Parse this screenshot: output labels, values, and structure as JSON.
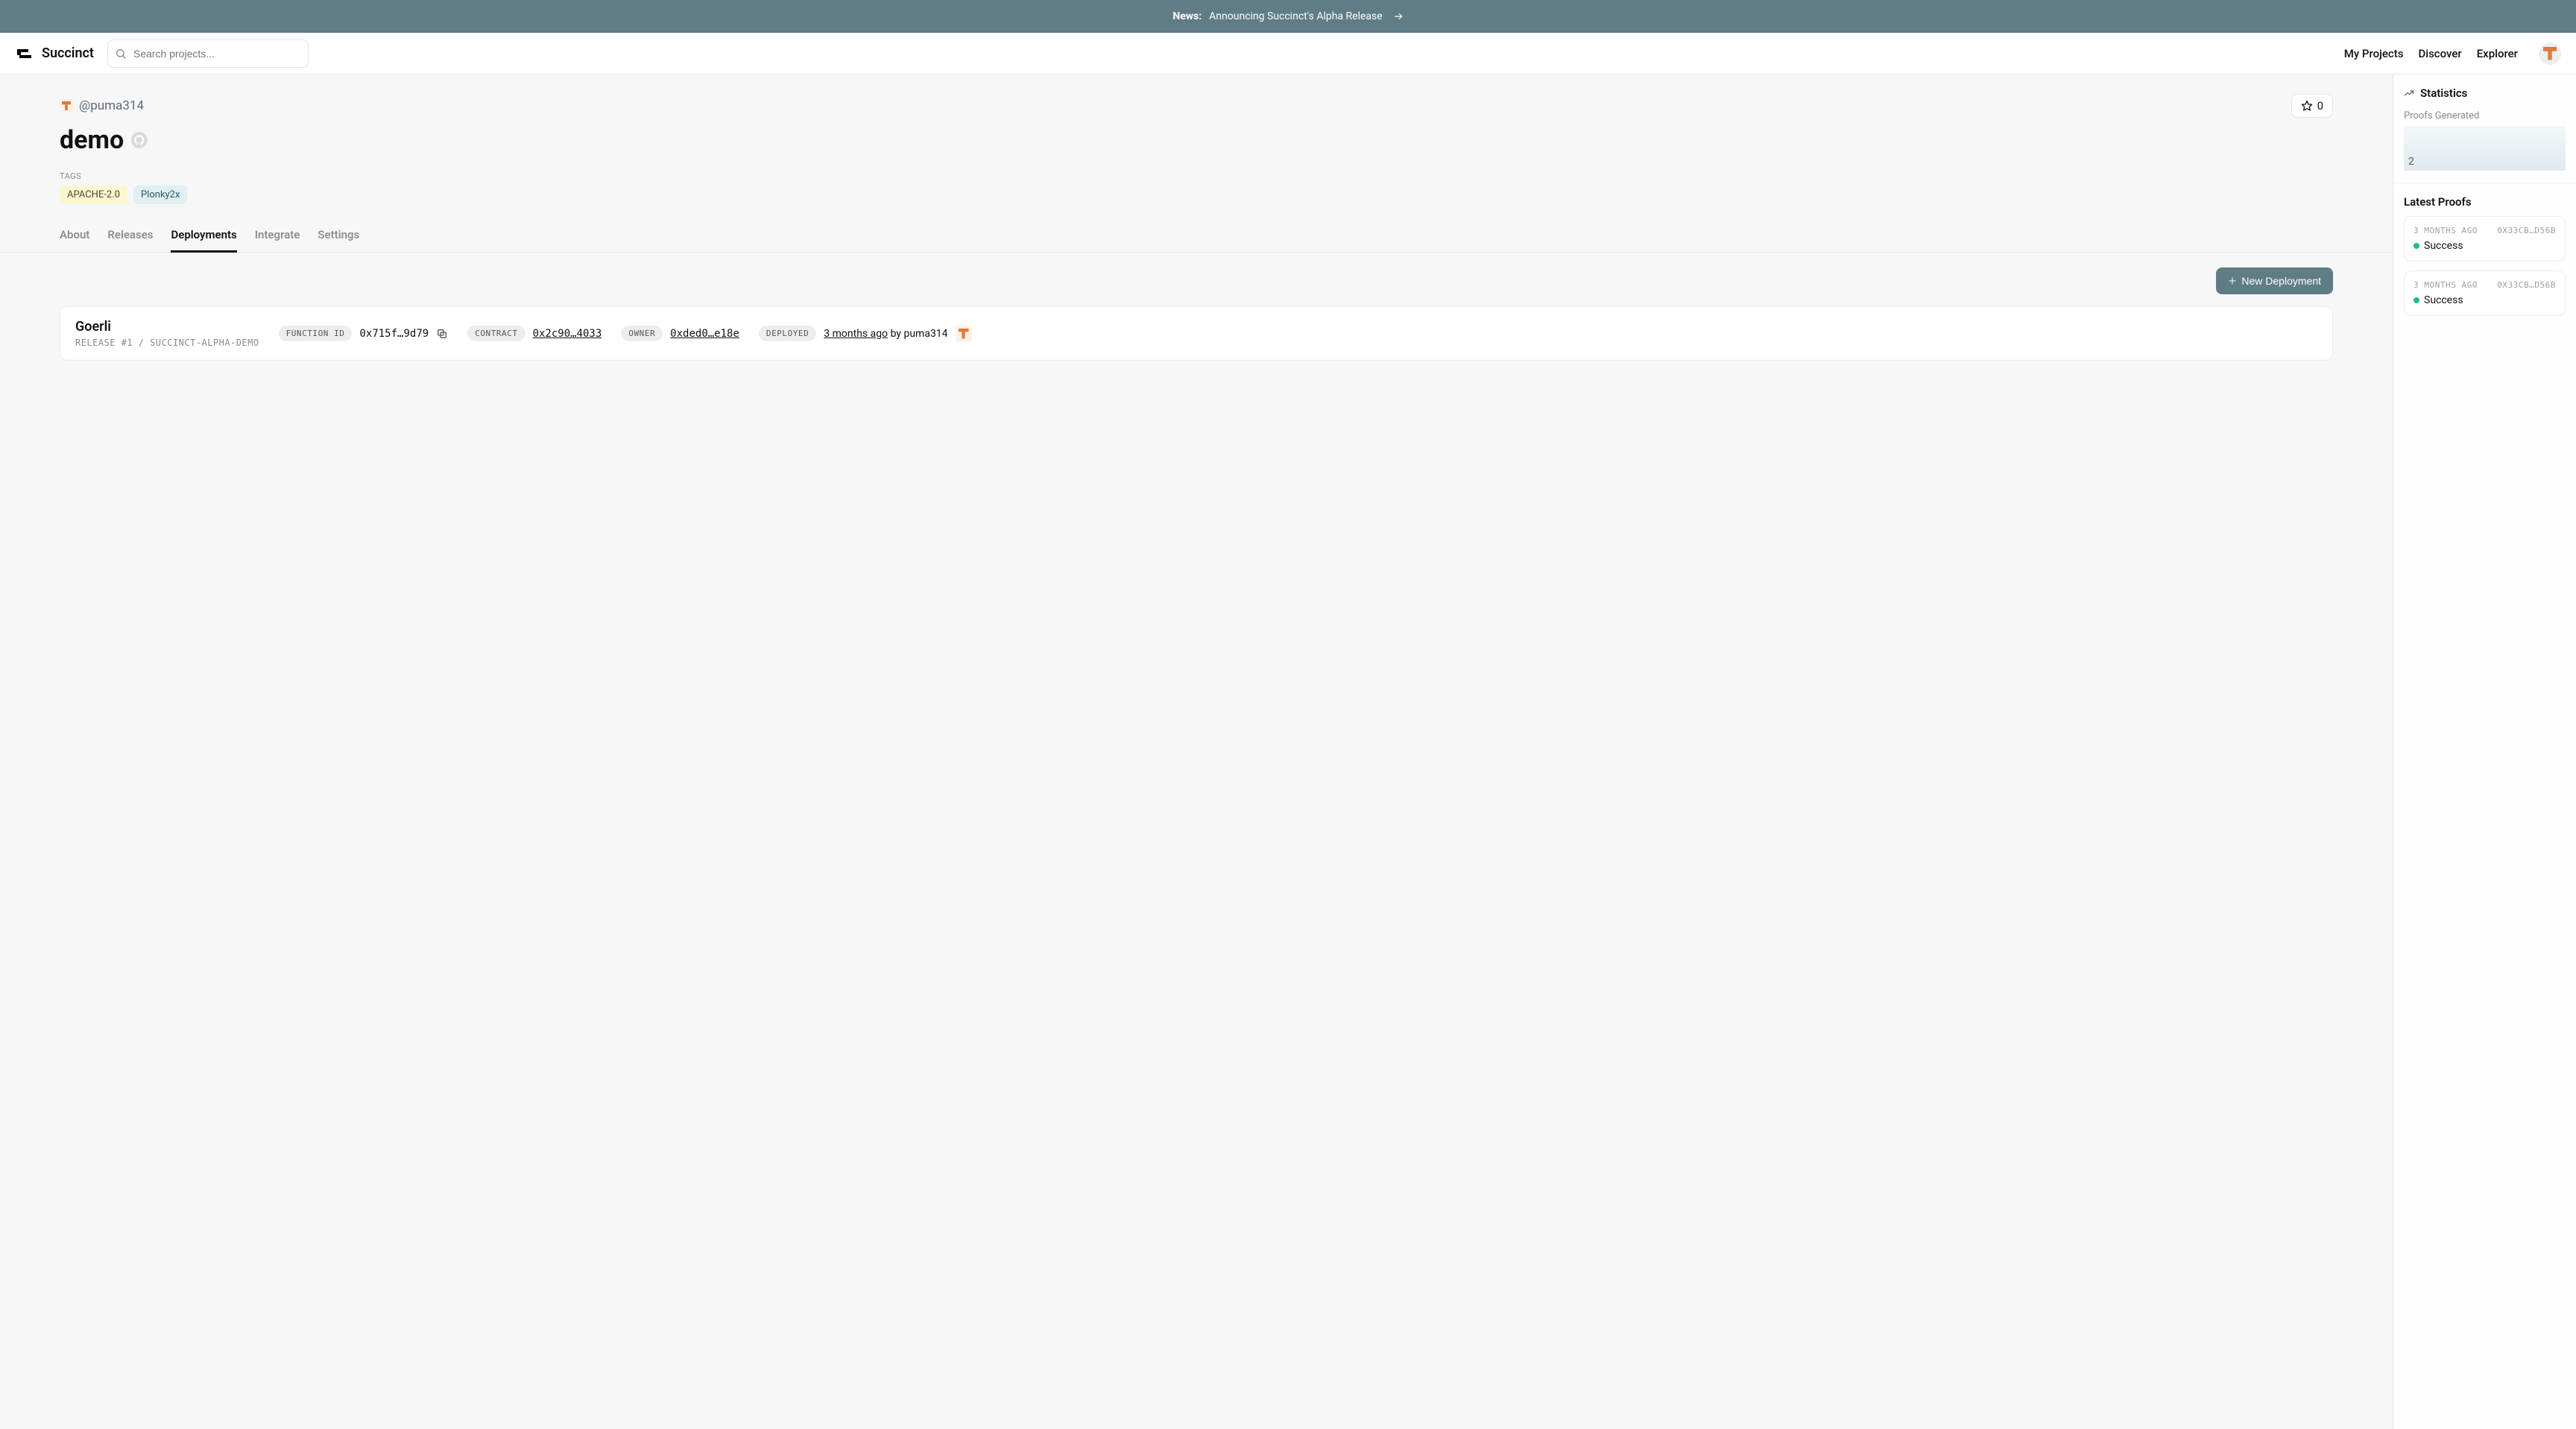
{
  "banner": {
    "news_label": "News:",
    "headline": "Announcing Succinct's Alpha Release"
  },
  "brand": {
    "name": "Succinct"
  },
  "search": {
    "placeholder": "Search projects..."
  },
  "nav": {
    "my_projects": "My Projects",
    "discover": "Discover",
    "explorer": "Explorer"
  },
  "project": {
    "owner_handle": "@puma314",
    "star_count": "0",
    "title": "demo",
    "tags_label": "TAGS",
    "tags": [
      {
        "text": "APACHE-2.0",
        "variant": "yellow"
      },
      {
        "text": "Plonky2x",
        "variant": "blue"
      }
    ]
  },
  "tabs": {
    "about": "About",
    "releases": "Releases",
    "deployments": "Deployments",
    "integrate": "Integrate",
    "settings": "Settings",
    "active": "deployments"
  },
  "actions": {
    "new_deployment": "New Deployment"
  },
  "deployment": {
    "network": "Goerli",
    "subtitle": "RELEASE #1 / SUCCINCT-ALPHA-DEMO",
    "function_id_label": "FUNCTION ID",
    "function_id_value": "0x715f…9d79",
    "contract_label": "CONTRACT",
    "contract_value": "0x2c90…4033",
    "owner_label": "OWNER",
    "owner_value": "0xded0…e18e",
    "deployed_label": "DEPLOYED",
    "deployed_time": "3 months ago",
    "by_text": "by",
    "by_user": "puma314"
  },
  "sidebar": {
    "stats_title": "Statistics",
    "proofs_generated_label": "Proofs Generated",
    "proofs_generated_count": "2",
    "latest_title": "Latest Proofs",
    "proofs": [
      {
        "age": "3 MONTHS AGO",
        "hash": "0x33cb…d56b",
        "status": "Success"
      },
      {
        "age": "3 MONTHS AGO",
        "hash": "0x33cb…d56b",
        "status": "Success"
      }
    ]
  }
}
